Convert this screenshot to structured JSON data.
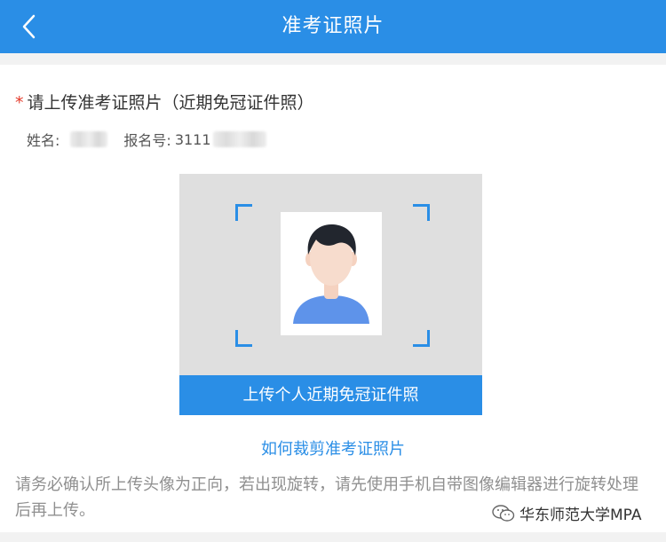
{
  "header": {
    "title": "准考证照片",
    "back_icon": "chevron-left-icon"
  },
  "form": {
    "required_mark": "*",
    "label": "请上传准考证照片（近期免冠证件照）",
    "name_label": "姓名:",
    "reg_label": "报名号:",
    "reg_prefix": "3111"
  },
  "upload": {
    "placeholder_icon": "person-avatar-icon",
    "button_label": "上传个人近期免冠证件照"
  },
  "help_link": "如何裁剪准考证照片",
  "notice": "请务必确认所上传头像为正向，若出现旋转，请先使用手机自带图像编辑器进行旋转处理后再上传。",
  "watermark": {
    "text": "华东师范大学MPA",
    "icon": "wechat-icon"
  },
  "colors": {
    "accent": "#2a8ee6",
    "required": "#e43b2b",
    "placeholder_bg": "#dfdfdf"
  }
}
